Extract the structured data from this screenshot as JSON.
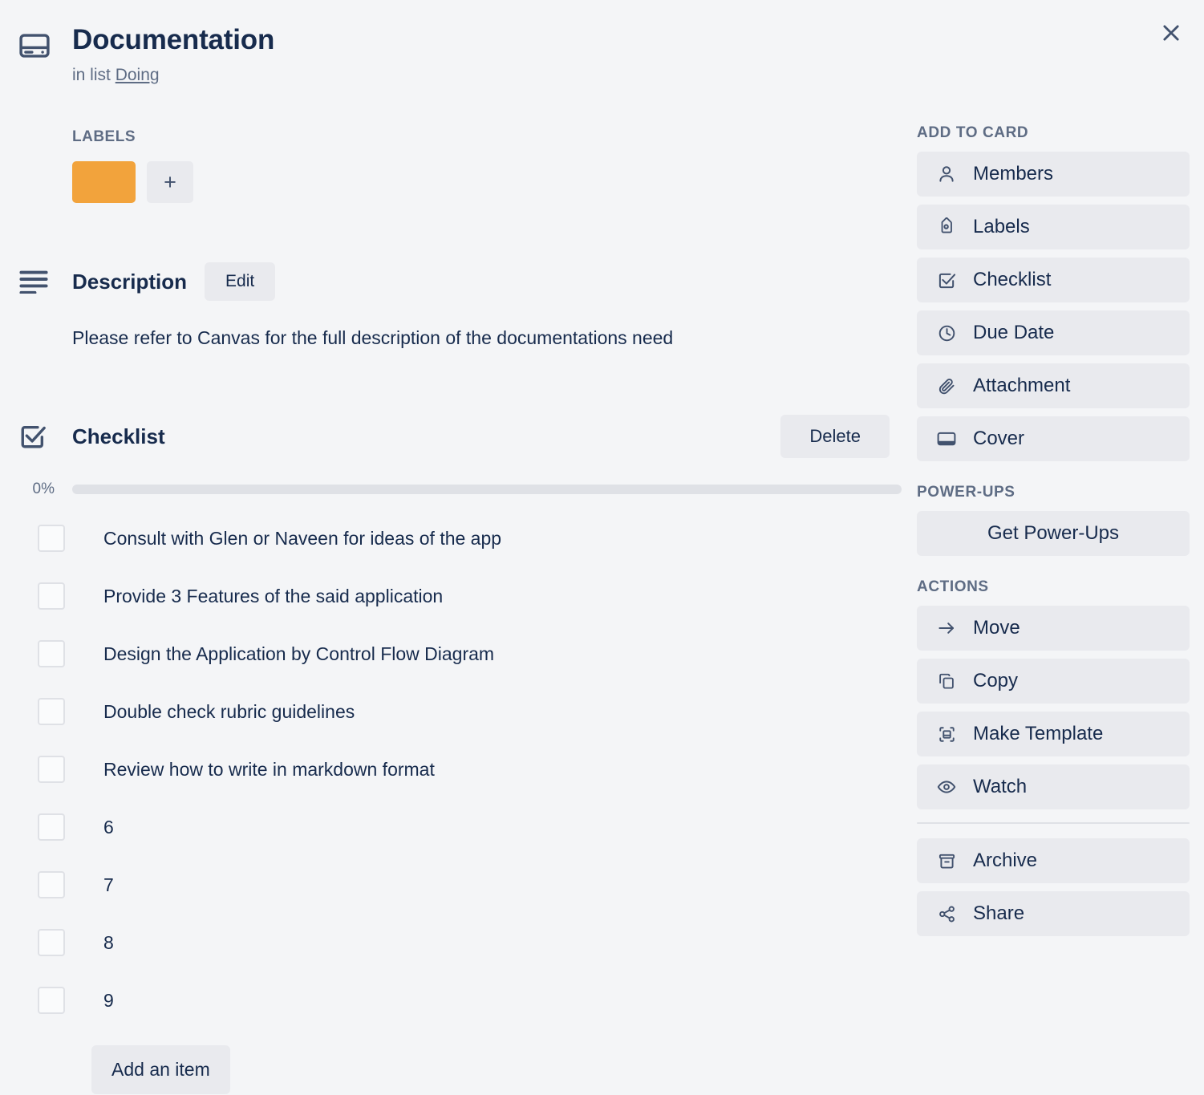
{
  "window": {
    "close_label": "×"
  },
  "header": {
    "icon": "cover-card-icon",
    "title": "Documentation",
    "subtitle_prefix": "in list",
    "list_name": "Doing"
  },
  "labels": {
    "caption": "LABELS",
    "chips": [
      {
        "color": "#f2a33c",
        "name": "orange-label"
      }
    ],
    "add_label": "+"
  },
  "description": {
    "title": "Description",
    "edit_label": "Edit",
    "body": "Please refer to Canvas for the full description of the documentations need"
  },
  "checklist": {
    "title": "Checklist",
    "delete_label": "Delete",
    "progress_percent_label": "0%",
    "progress_percent_value": 0,
    "items": [
      {
        "label": "Consult with Glen or Naveen for ideas of the app",
        "checked": false
      },
      {
        "label": "Provide 3 Features of the said application",
        "checked": false
      },
      {
        "label": "Design the Application by Control Flow Diagram",
        "checked": false
      },
      {
        "label": "Double check rubric guidelines",
        "checked": false
      },
      {
        "label": "Review how to write in markdown format",
        "checked": false
      },
      {
        "label": "6",
        "checked": false
      },
      {
        "label": "7",
        "checked": false
      },
      {
        "label": "8",
        "checked": false
      },
      {
        "label": "9",
        "checked": false
      }
    ],
    "add_item_label": "Add an item"
  },
  "sidebar": {
    "add_to_card": {
      "heading": "ADD TO CARD",
      "items": [
        {
          "label": "Members",
          "icon": "person-icon"
        },
        {
          "label": "Labels",
          "icon": "tag-icon"
        },
        {
          "label": "Checklist",
          "icon": "checkbox-check-icon"
        },
        {
          "label": "Due Date",
          "icon": "clock-icon"
        },
        {
          "label": "Attachment",
          "icon": "paperclip-icon"
        },
        {
          "label": "Cover",
          "icon": "cover-icon"
        }
      ]
    },
    "power_ups": {
      "heading": "POWER-UPS",
      "items": [
        {
          "label": "Get Power-Ups",
          "icon": "none"
        }
      ]
    },
    "actions": {
      "heading": "ACTIONS",
      "items": [
        {
          "label": "Move",
          "icon": "arrow-right-icon"
        },
        {
          "label": "Copy",
          "icon": "copy-icon"
        },
        {
          "label": "Make Template",
          "icon": "template-icon"
        },
        {
          "label": "Watch",
          "icon": "eye-icon"
        }
      ],
      "items_after_separator": [
        {
          "label": "Archive",
          "icon": "archive-icon"
        },
        {
          "label": "Share",
          "icon": "share-icon"
        }
      ]
    }
  },
  "colors": {
    "background": "#f4f5f7",
    "text_primary": "#172b4d",
    "text_muted": "#5e6c84",
    "button_bg": "#e9eaee",
    "label_orange": "#f2a33c",
    "progress_track": "#dfe1e6"
  }
}
